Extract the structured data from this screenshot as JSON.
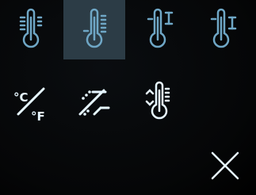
{
  "menu": {
    "selected_index": 1,
    "icons": [
      "thermometer-scale-left-icon",
      "thermometer-scale-right-icon",
      "thermometer-upper-limit-icon",
      "thermometer-lower-limit-icon",
      "celsius-fahrenheit-icon",
      "calibration-offset-icon",
      "thermometer-adjust-icon",
      "close-icon"
    ],
    "unit_toggle": {
      "top": "°C",
      "bottom": "°F"
    }
  },
  "colors": {
    "icon": "#e6f6ff",
    "icon_selected": "#6fa7c6",
    "background": "#000000",
    "selected_tile": "#2c3c46"
  }
}
